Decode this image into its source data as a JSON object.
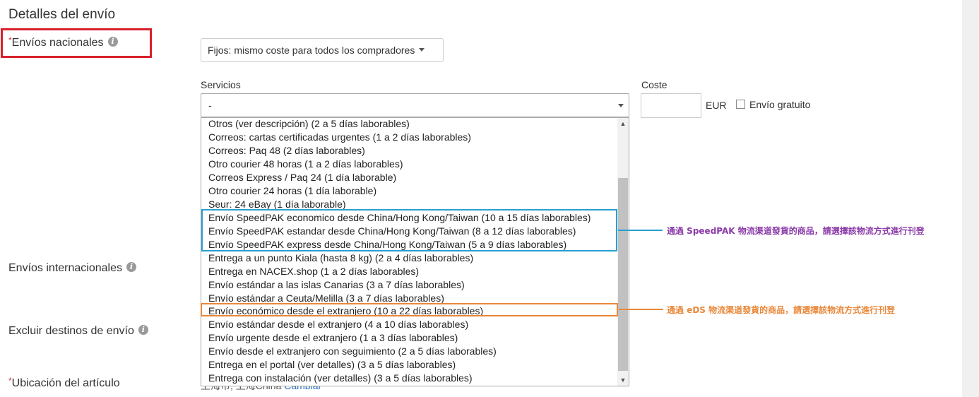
{
  "section_title": "Detalles del envío",
  "domestic": {
    "required_mark": "*",
    "label": "Envíos nacionales",
    "type_dropdown": "Fijos: mismo coste para todos los compradores"
  },
  "services": {
    "label": "Servicios",
    "selected": "-",
    "options": [
      "Otros (ver descripción) (2 a 5 días laborables)",
      "Correos: cartas certificadas urgentes (1 a 2 días laborables)",
      "Correos: Paq 48 (2 días laborables)",
      "Otro courier 48 horas (1 a 2 días laborables)",
      "Correos Express / Paq 24 (1 día laborable)",
      "Otro courier 24 horas (1 día laborable)",
      "Seur: 24 eBay (1 día laborable)",
      "Envío SpeedPAK economico desde China/Hong Kong/Taiwan (10 a 15 días laborables)",
      "Envío SpeedPAK estandar desde China/Hong Kong/Taiwan (8 a 12 días laborables)",
      "Envío SpeedPAK express desde China/Hong Kong/Taiwan (5 a 9 días laborables)",
      "Entrega a un punto Kiala (hasta 8 kg) (2 a 4 días laborables)",
      "Entrega en NACEX.shop (1 a 2 días laborables)",
      "Envío estándar a las islas Canarias (3 a 7 días laborables)",
      "Envío estándar a Ceuta/Melilla (3 a 7 días laborables)",
      "Envío económico desde el extranjero (10 a 22 días laborables)",
      "Envío estándar desde el extranjero (4 a 10 días laborables)",
      "Envío urgente desde el extranjero (1 a 3 días laborables)",
      "Envío desde el extranjero con seguimiento (2 a 5 días laborables)",
      "Entrega en el portal (ver detalles) (3 a 5 días laborables)",
      "Entrega con instalación (ver detalles) (3 a 5 días laborables)"
    ]
  },
  "cost": {
    "label": "Coste",
    "currency": "EUR",
    "free_shipping_label": "Envío gratuito"
  },
  "international": {
    "label": "Envíos internacionales"
  },
  "exclude": {
    "label": "Excluir destinos de envío"
  },
  "location": {
    "required_mark": "*",
    "label": "Ubicación del artículo",
    "value_partial": "上海市, 上海China",
    "change_link": "Cambiar"
  },
  "annotations": {
    "speedpak_note": "通過 SpeedPAK 物流渠道發貨的商品，請選擇該物流方式進行刊登",
    "eds_note": "通過 eDS 物流渠道發貨的商品，請選擇該物流方式進行刊登"
  },
  "colors": {
    "red_highlight": "#d9202a",
    "blue_highlight": "#2a9fd0",
    "orange_highlight": "#e9883a",
    "speedpak_note_text": "#8a3aa8"
  }
}
